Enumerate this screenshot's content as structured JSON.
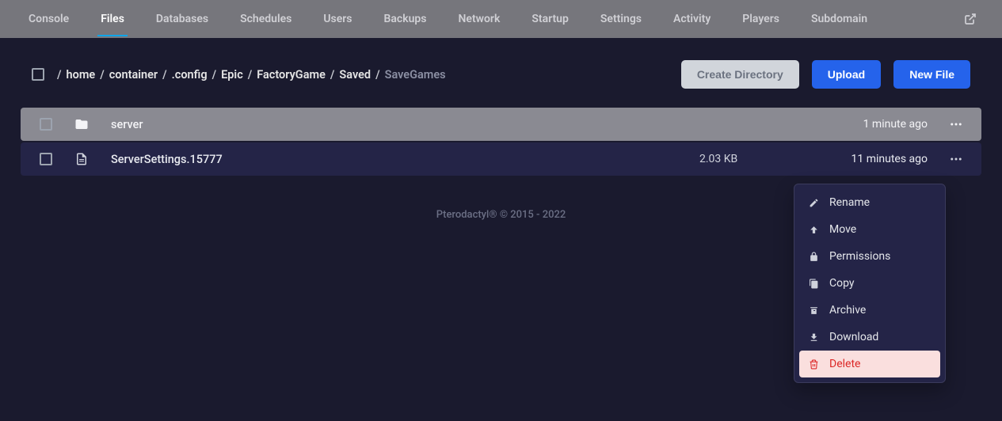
{
  "tabs": {
    "items": [
      {
        "label": "Console"
      },
      {
        "label": "Files"
      },
      {
        "label": "Databases"
      },
      {
        "label": "Schedules"
      },
      {
        "label": "Users"
      },
      {
        "label": "Backups"
      },
      {
        "label": "Network"
      },
      {
        "label": "Startup"
      },
      {
        "label": "Settings"
      },
      {
        "label": "Activity"
      },
      {
        "label": "Players"
      },
      {
        "label": "Subdomain"
      }
    ],
    "active_index": 1
  },
  "breadcrumb": {
    "parts": [
      "home",
      "container",
      ".config",
      "Epic",
      "FactoryGame",
      "Saved",
      "SaveGames"
    ]
  },
  "buttons": {
    "create_directory": "Create Directory",
    "upload": "Upload",
    "new_file": "New File"
  },
  "files": [
    {
      "icon": "folder",
      "name": "server",
      "size": "",
      "time": "1 minute ago"
    },
    {
      "icon": "file",
      "name": "ServerSettings.15777",
      "size": "2.03 KB",
      "time": "11 minutes ago"
    }
  ],
  "context_menu": {
    "items": [
      {
        "icon": "pencil",
        "label": "Rename"
      },
      {
        "icon": "arrow-up",
        "label": "Move"
      },
      {
        "icon": "lock",
        "label": "Permissions"
      },
      {
        "icon": "copy",
        "label": "Copy"
      },
      {
        "icon": "archive",
        "label": "Archive"
      },
      {
        "icon": "download",
        "label": "Download"
      },
      {
        "icon": "trash",
        "label": "Delete",
        "danger": true
      }
    ]
  },
  "footer": "Pterodactyl® © 2015 - 2022"
}
